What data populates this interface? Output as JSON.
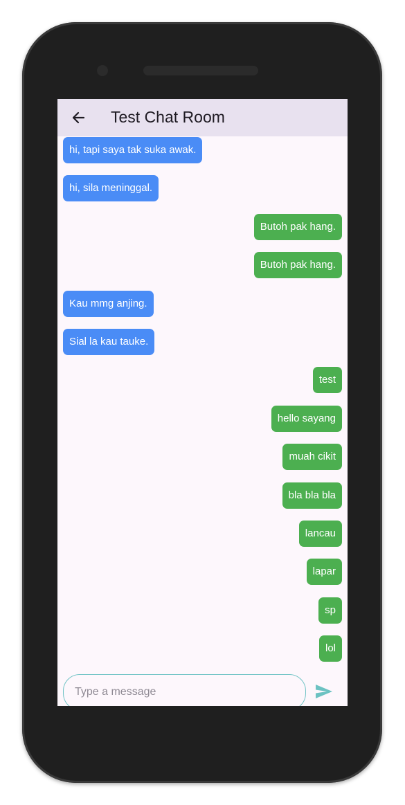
{
  "appbar": {
    "title": "Test Chat Room",
    "back_icon": "arrow-back-icon"
  },
  "messages": [
    {
      "text": "hi, tapi saya tak suka awak.",
      "direction": "received"
    },
    {
      "text": "hi, sila meninggal.",
      "direction": "received"
    },
    {
      "text": "Butoh pak hang.",
      "direction": "sent"
    },
    {
      "text": "Butoh pak hang.",
      "direction": "sent"
    },
    {
      "text": "Kau mmg anjing.",
      "direction": "received"
    },
    {
      "text": "Sial la kau tauke.",
      "direction": "received"
    },
    {
      "text": "test",
      "direction": "sent"
    },
    {
      "text": "hello sayang",
      "direction": "sent"
    },
    {
      "text": "muah cikit",
      "direction": "sent"
    },
    {
      "text": "bla bla bla",
      "direction": "sent"
    },
    {
      "text": "lancau",
      "direction": "sent"
    },
    {
      "text": "lapar",
      "direction": "sent"
    },
    {
      "text": "sp",
      "direction": "sent"
    },
    {
      "text": "lol",
      "direction": "sent"
    }
  ],
  "composer": {
    "placeholder": "Type a message",
    "value": "",
    "send_icon": "send-icon"
  },
  "colors": {
    "appbar_bg": "#e8e1ef",
    "screen_bg": "#fdf7fc",
    "received_bubble": "#4a8cf6",
    "sent_bubble": "#4caf50",
    "input_border": "#72c4c6",
    "send_icon": "#6cc2c2"
  }
}
